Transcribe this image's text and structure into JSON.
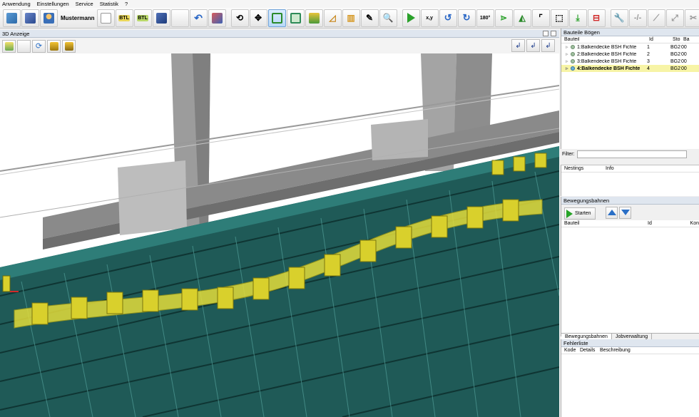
{
  "menu": [
    "Anwendung",
    "Einstellungen",
    "Service",
    "Statistik",
    "?"
  ],
  "toolbar": {
    "user": "Mustermann",
    "btl1": "BTL",
    "btl2": "BTL",
    "xy": "x,y",
    "deg": "180°"
  },
  "panel3d": {
    "title": "3D Anzeige"
  },
  "bauteile": {
    "title": "Bauteile Bögen",
    "headers": {
      "name": "Bauteil",
      "id": "Id",
      "sto": "Sto",
      "ba": "Ba"
    },
    "rows": [
      {
        "name": "1:Balkendecke BSH Fichte",
        "id": "1",
        "sto": "BG2",
        "ba": "00"
      },
      {
        "name": "2:Balkendecke BSH Fichte",
        "id": "2",
        "sto": "BG2",
        "ba": "00"
      },
      {
        "name": "3:Balkendecke BSH Fichte",
        "id": "3",
        "sto": "BG2",
        "ba": "00"
      },
      {
        "name": "4:Balkendecke BSH Fichte",
        "id": "4",
        "sto": "BG2",
        "ba": "00"
      }
    ],
    "selected_index": 3
  },
  "filter": {
    "label": "Filter:"
  },
  "nestings": {
    "headers": {
      "nestings": "Nestings",
      "info": "Info"
    }
  },
  "bewegungsbahnen": {
    "title": "Bewegungsbahnen",
    "start_label": "Starten",
    "headers": {
      "bauteil": "Bauteil",
      "id": "Id",
      "kon": "Kon"
    },
    "tabs": [
      "Bewegungsbahnen",
      "Jobverwaltung"
    ]
  },
  "fehlerliste": {
    "title": "Fehlerliste",
    "headers": [
      "Kode",
      "Details",
      "Beschreibung"
    ]
  },
  "colors": {
    "machine_teal": "#1f5a57",
    "machine_teal_light": "#2e7d78",
    "part_yellow": "#e3dc3a",
    "concrete": "#a6a6a6",
    "selection": "#f7f4a6"
  }
}
